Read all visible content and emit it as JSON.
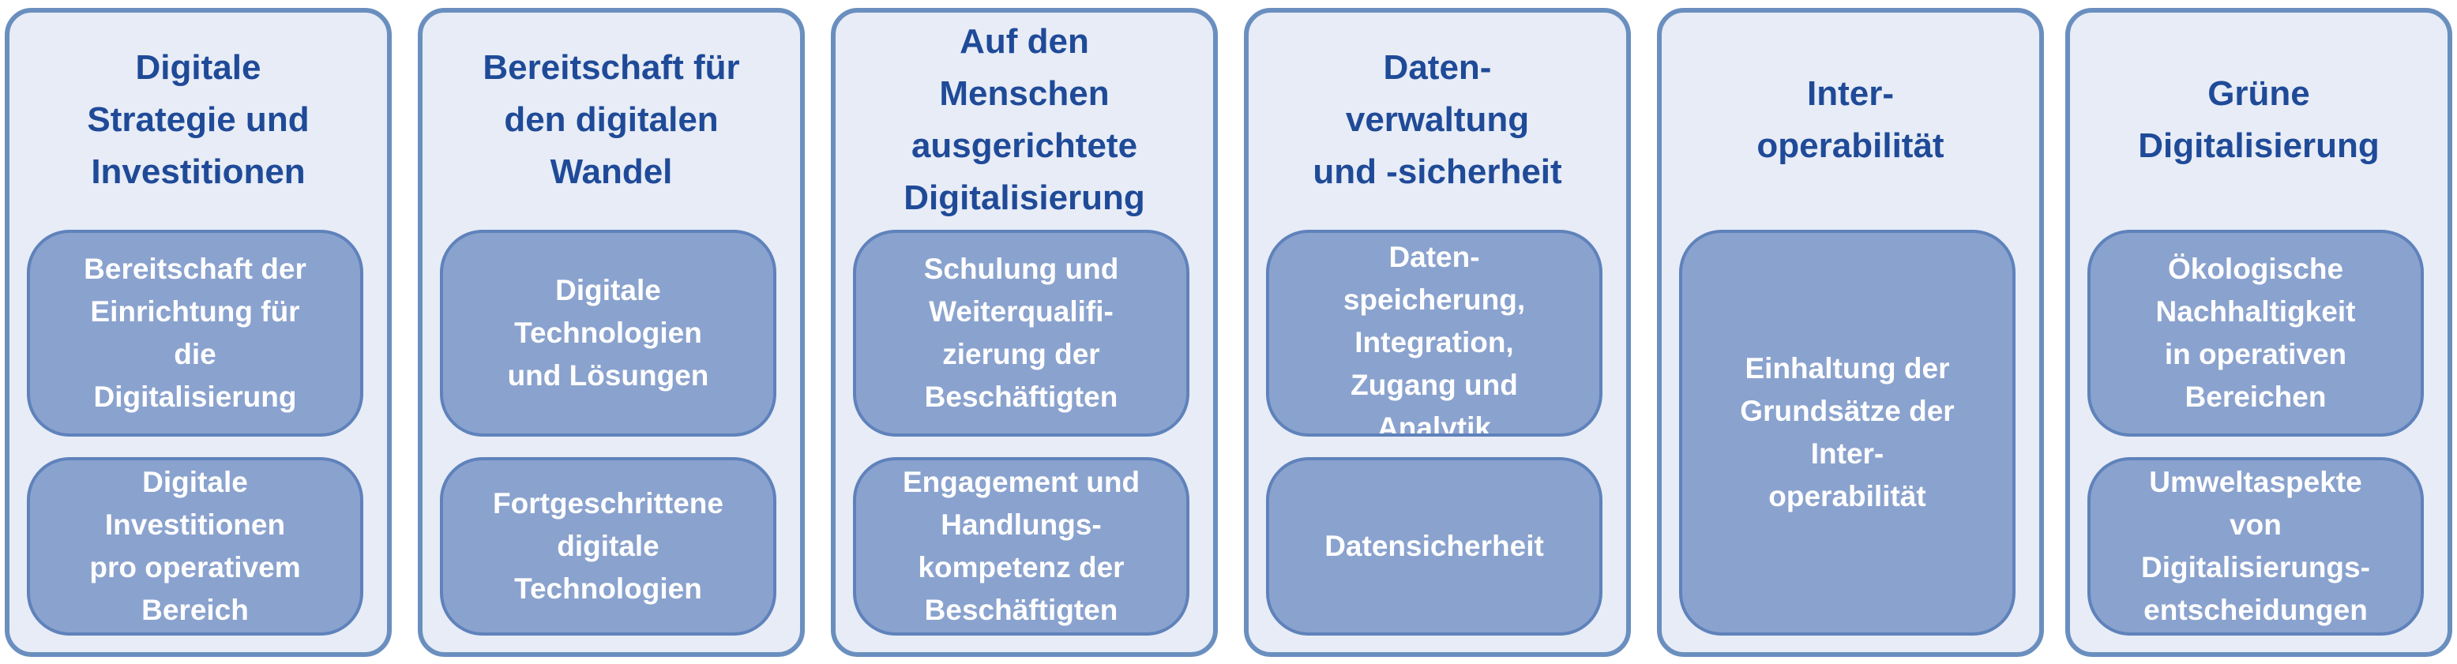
{
  "columns": [
    {
      "title": "Digitale\nStrategie und\nInvestitionen",
      "boxes": [
        "Bereitschaft der\nEinrichtung für\ndie\nDigitalisierung",
        "Digitale\nInvestitionen\npro operativem\nBereich"
      ]
    },
    {
      "title": "Bereitschaft für\nden digitalen\nWandel",
      "boxes": [
        "Digitale\nTechnologien\nund Lösungen",
        "Fortgeschrittene\ndigitale\nTechnologien"
      ]
    },
    {
      "title": "Auf den\nMenschen\nausgerichtete\nDigitalisierung",
      "boxes": [
        "Schulung und\nWeiterqualifi-\nzierung der\nBeschäftigten",
        "Engagement und\nHandlungs-\nkompetenz der\nBeschäftigten"
      ]
    },
    {
      "title": "Daten-\nverwaltung\nund -sicherheit",
      "boxes": [
        "Daten-\nspeicherung,\nIntegration,\nZugang und\nAnalytik",
        "Datensicherheit"
      ]
    },
    {
      "title": "Inter-\noperabilität",
      "boxes": [
        "Einhaltung der\nGrundsätze der\nInter-\noperabilität"
      ]
    },
    {
      "title": "Grüne\nDigitalisierung",
      "boxes": [
        "Ökologische\nNachhaltigkeit\nin operativen\nBereichen",
        "Umweltaspekte\nvon\nDigitalisierungs-\nentscheidungen"
      ]
    }
  ]
}
